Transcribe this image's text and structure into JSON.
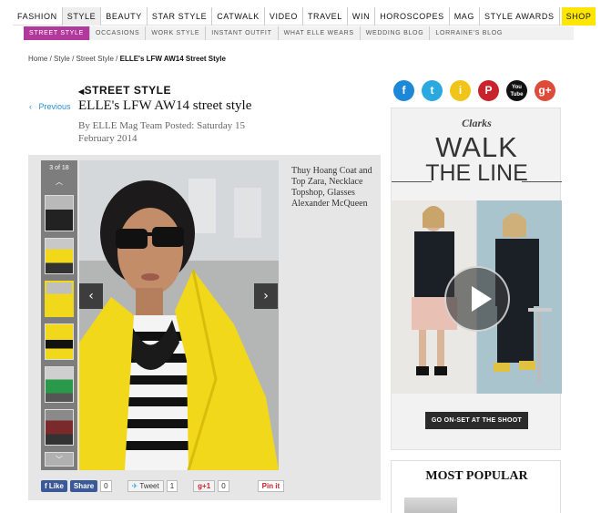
{
  "topnav": {
    "items": [
      "FASHION",
      "STYLE",
      "BEAUTY",
      "STAR STYLE",
      "CATWALK",
      "VIDEO",
      "TRAVEL",
      "WIN",
      "HOROSCOPES",
      "MAG",
      "STYLE AWARDS"
    ],
    "shop": "SHOP",
    "active": "STYLE"
  },
  "subnav": {
    "items": [
      "STREET STYLE",
      "OCCASIONS",
      "WORK STYLE",
      "INSTANT OUTFIT",
      "WHAT ELLE WEARS",
      "WEDDING BLOG",
      "LORRAINE'S BLOG"
    ],
    "active": "STREET STYLE"
  },
  "breadcrumb": {
    "home": "Home",
    "style": "Style",
    "street": "Street Style",
    "current": "ELLE's LFW AW14 Street Style",
    "sep": "/"
  },
  "article": {
    "previous": "Previous",
    "kicker": "STREET STYLE",
    "title": "ELLE's LFW AW14 street style",
    "byline": "By ELLE Mag Team Posted: Saturday 15 February 2014"
  },
  "gallery": {
    "counter": "3 of 18",
    "caption": "Thuy Hoang Coat and Top Zara, Necklace Topshop, Glasses Alexander McQueen",
    "thumb_count": 7
  },
  "share": {
    "fb_like": "Like",
    "fb_share": "Share",
    "fb_count": "0",
    "tweet": "Tweet",
    "tweet_count": "1",
    "gplus": "g+1",
    "gplus_count": "0",
    "pin": "Pin it"
  },
  "social": [
    "f",
    "t",
    "i",
    "P",
    "You Tube",
    "g+"
  ],
  "social_colors": [
    "#1e88d8",
    "#2aa9e0",
    "#f0c419",
    "#c8232c",
    "#111111",
    "#dd4b39"
  ],
  "ad": {
    "brand": "Clarks",
    "headline1": "WALK",
    "headline2": "THE LINE",
    "cta": "GO ON-SET AT THE SHOOT"
  },
  "popular": {
    "title": "MOST POPULAR"
  },
  "colors": {
    "accent_shop": "#ffe600",
    "subnav_active": "#b2399c",
    "link": "#2a8fd0",
    "coat": "#f2d81b"
  }
}
